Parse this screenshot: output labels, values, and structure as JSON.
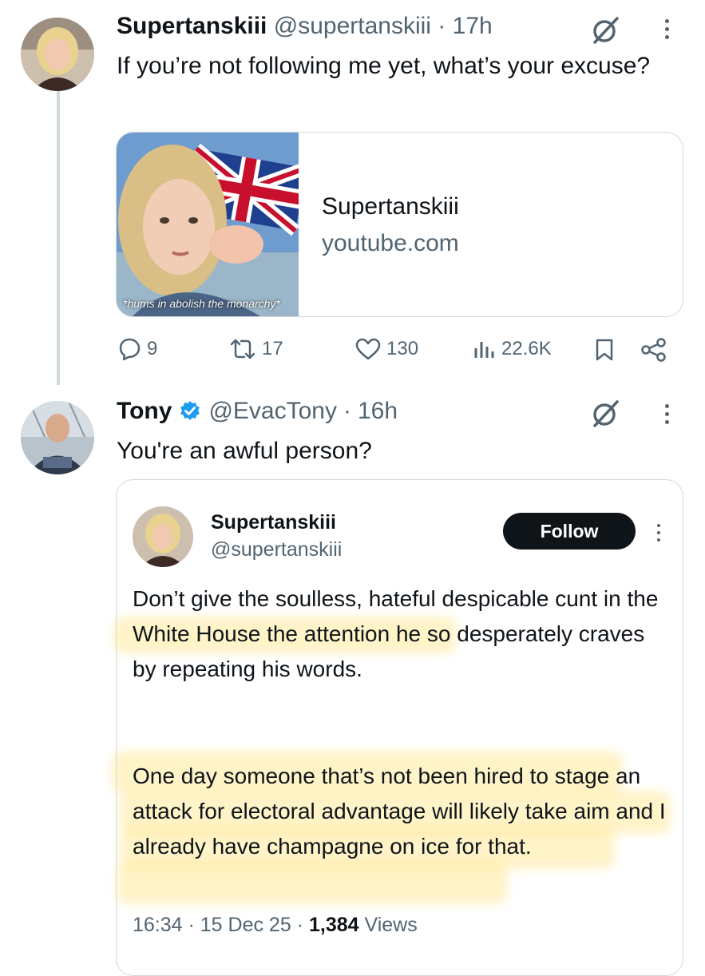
{
  "tweet1": {
    "display_name": "Supertanskiii",
    "handle": "@supertanskiii",
    "time": "17h",
    "text": "If you’re not following me yet, what’s your excuse?",
    "link_card": {
      "title": "Supertanskiii",
      "domain": "youtube.com",
      "thumbnail_caption": "*hums in abolish the monarchy*"
    },
    "actions": {
      "replies": "9",
      "reposts": "17",
      "likes": "130",
      "views": "22.6K"
    }
  },
  "tweet2": {
    "display_name": "Tony",
    "handle": "@EvacTony",
    "time": "16h",
    "text": "You're an awful person?",
    "verified_color": "#1d9bf0"
  },
  "quoted": {
    "display_name": "Supertanskiii",
    "handle": "@supertanskiii",
    "follow_label": "Follow",
    "paragraph1": "Don’t give the soulless, hateful despicable cunt in the White House the attention he so desperately craves by repeating his words.",
    "paragraph2": "One day someone that’s not been hired to stage an attack for electoral advantage will likely take aim and I already have champagne on ice for that.",
    "timestamp": "16:34 · 15 Dec 25 · ",
    "views_count": "1,384",
    "views_label": "Views"
  },
  "icons": [
    "grok-icon",
    "more-icon",
    "reply-icon",
    "repost-icon",
    "like-icon",
    "views-icon",
    "bookmark-icon",
    "share-icon",
    "verified-icon"
  ],
  "colors": {
    "text": "#0f1419",
    "secondary": "#536471",
    "border": "#cfd9de",
    "highlight": "#ffe06e",
    "follow_bg": "#0f1419"
  }
}
